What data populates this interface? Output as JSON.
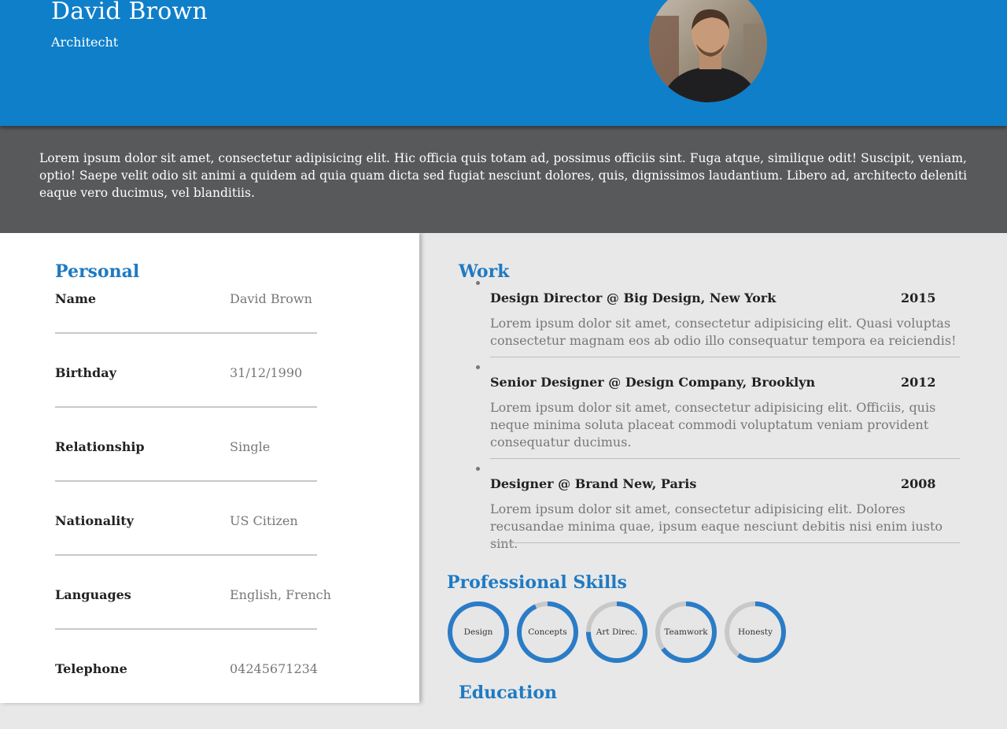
{
  "header": {
    "name": "David Brown",
    "role": "Architecht",
    "accent_color": "#0f7fca"
  },
  "summary": {
    "text": "Lorem ipsum dolor sit amet, consectetur adipisicing elit. Hic officia quis totam ad, possimus officiis sint. Fuga atque, similique odit! Suscipit, veniam, optio! Saepe velit odio sit animi a quidem ad quia quam dicta sed fugiat nesciunt dolores, quis, dignissimos laudantium. Libero ad, architecto deleniti eaque vero ducimus, vel blanditiis."
  },
  "personal": {
    "title": "Personal",
    "rows": [
      {
        "label": "Name",
        "value": "David Brown"
      },
      {
        "label": "Birthday",
        "value": "31/12/1990"
      },
      {
        "label": "Relationship",
        "value": "Single"
      },
      {
        "label": "Nationality",
        "value": "US Citizen"
      },
      {
        "label": "Languages",
        "value": "English, French"
      },
      {
        "label": "Telephone",
        "value": "04245671234"
      }
    ]
  },
  "work": {
    "title": "Work",
    "jobs": [
      {
        "title": "Design Director @ Big Design, New York",
        "year": "2015",
        "desc": "Lorem ipsum dolor sit amet, consectetur adipisicing elit. Quasi voluptas consectetur magnam eos ab odio illo consequatur tempora ea reiciendis!"
      },
      {
        "title": "Senior Designer @ Design Company, Brooklyn",
        "year": "2012",
        "desc": "Lorem ipsum dolor sit amet, consectetur adipisicing elit. Officiis, quis neque minima soluta placeat commodi voluptatum veniam provident consequatur ducimus."
      },
      {
        "title": "Designer @ Brand New, Paris",
        "year": "2008",
        "desc": "Lorem ipsum dolor sit amet, consectetur adipisicing elit. Dolores recusandae minima quae, ipsum eaque nesciunt debitis nisi enim iusto sint."
      }
    ]
  },
  "skills": {
    "title": "Professional Skills",
    "ring_color": "#2b7cc7",
    "track_color": "#c8c8c8",
    "items": [
      {
        "label": "Design",
        "level": 1.0
      },
      {
        "label": "Concepts",
        "level": 0.93
      },
      {
        "label": "Art Direc.",
        "level": 0.75
      },
      {
        "label": "Teamwork",
        "level": 0.65
      },
      {
        "label": "Honesty",
        "level": 0.6
      }
    ]
  },
  "education": {
    "title": "Education"
  }
}
